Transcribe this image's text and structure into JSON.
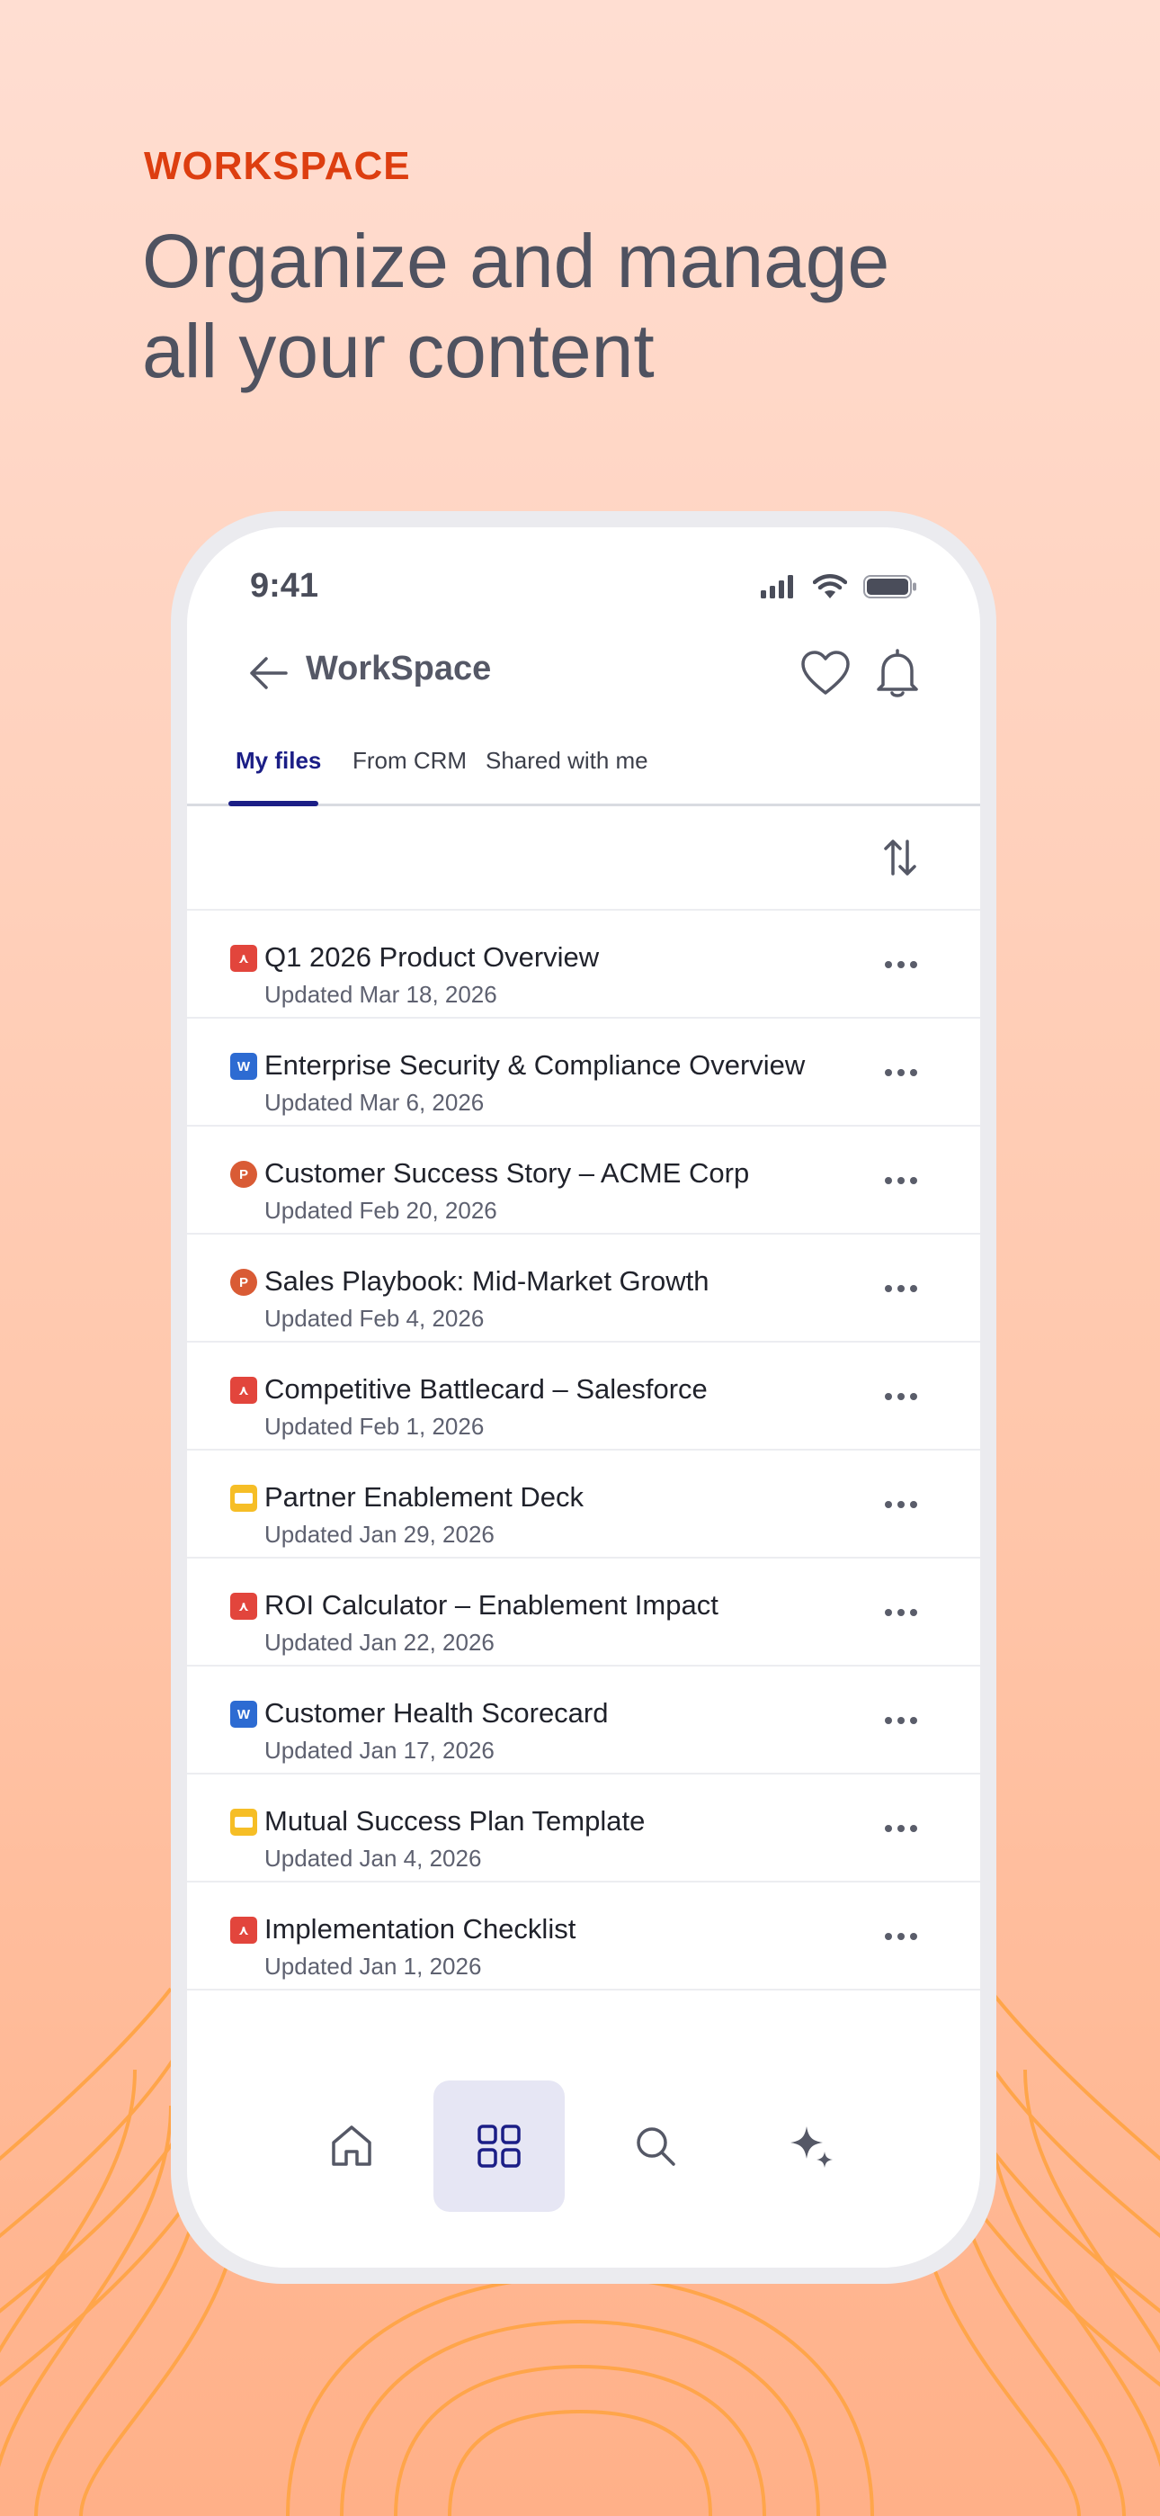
{
  "hero": {
    "eyebrow": "WORKSPACE",
    "headline_line1": "Organize and manage",
    "headline_line2": "all your content"
  },
  "status_bar": {
    "time": "9:41",
    "icons": [
      "signal-icon",
      "wifi-icon",
      "battery-icon"
    ]
  },
  "app_bar": {
    "title": "WorkSpace",
    "icons": [
      "back-arrow-icon",
      "heart-icon",
      "bell-icon"
    ]
  },
  "tabs": [
    {
      "label": "My files",
      "active": true
    },
    {
      "label": "From CRM",
      "active": false
    },
    {
      "label": "Shared with me",
      "active": false
    }
  ],
  "files": [
    {
      "name": "Q1 2026 Product Overview",
      "updated": "Updated Mar 18, 2026",
      "type": "pdf"
    },
    {
      "name": "Enterprise Security & Compliance Overview",
      "updated": "Updated Mar 6, 2026",
      "type": "word"
    },
    {
      "name": "Customer Success Story – ACME Corp",
      "updated": "Updated Feb 20, 2026",
      "type": "powerpoint"
    },
    {
      "name": "Sales Playbook: Mid-Market Growth",
      "updated": "Updated Feb 4, 2026",
      "type": "powerpoint"
    },
    {
      "name": "Competitive Battlecard – Salesforce",
      "updated": "Updated Feb 1, 2026",
      "type": "pdf"
    },
    {
      "name": "Partner Enablement Deck",
      "updated": "Updated Jan 29, 2026",
      "type": "slides"
    },
    {
      "name": "ROI Calculator – Enablement Impact",
      "updated": "Updated Jan 22, 2026",
      "type": "pdf"
    },
    {
      "name": "Customer Health Scorecard",
      "updated": "Updated Jan 17, 2026",
      "type": "word"
    },
    {
      "name": "Mutual Success Plan Template",
      "updated": "Updated Jan 4, 2026",
      "type": "slides"
    },
    {
      "name": "Implementation Checklist",
      "updated": "Updated Jan 1, 2026",
      "type": "pdf"
    }
  ],
  "bottom_nav": [
    {
      "icon": "home-icon",
      "active": false
    },
    {
      "icon": "grid-icon",
      "active": true
    },
    {
      "icon": "search-icon",
      "active": false
    },
    {
      "icon": "sparkle-icon",
      "active": false
    }
  ],
  "colors": {
    "accent": "#DD3E10",
    "tab_active": "#1B1E86",
    "headline": "#4F5260",
    "nav_active_bg": "#E6E6F4",
    "pdf": "#E2453C",
    "word": "#2D6BD2",
    "powerpoint": "#D95B35",
    "slides": "#F6BE26"
  }
}
